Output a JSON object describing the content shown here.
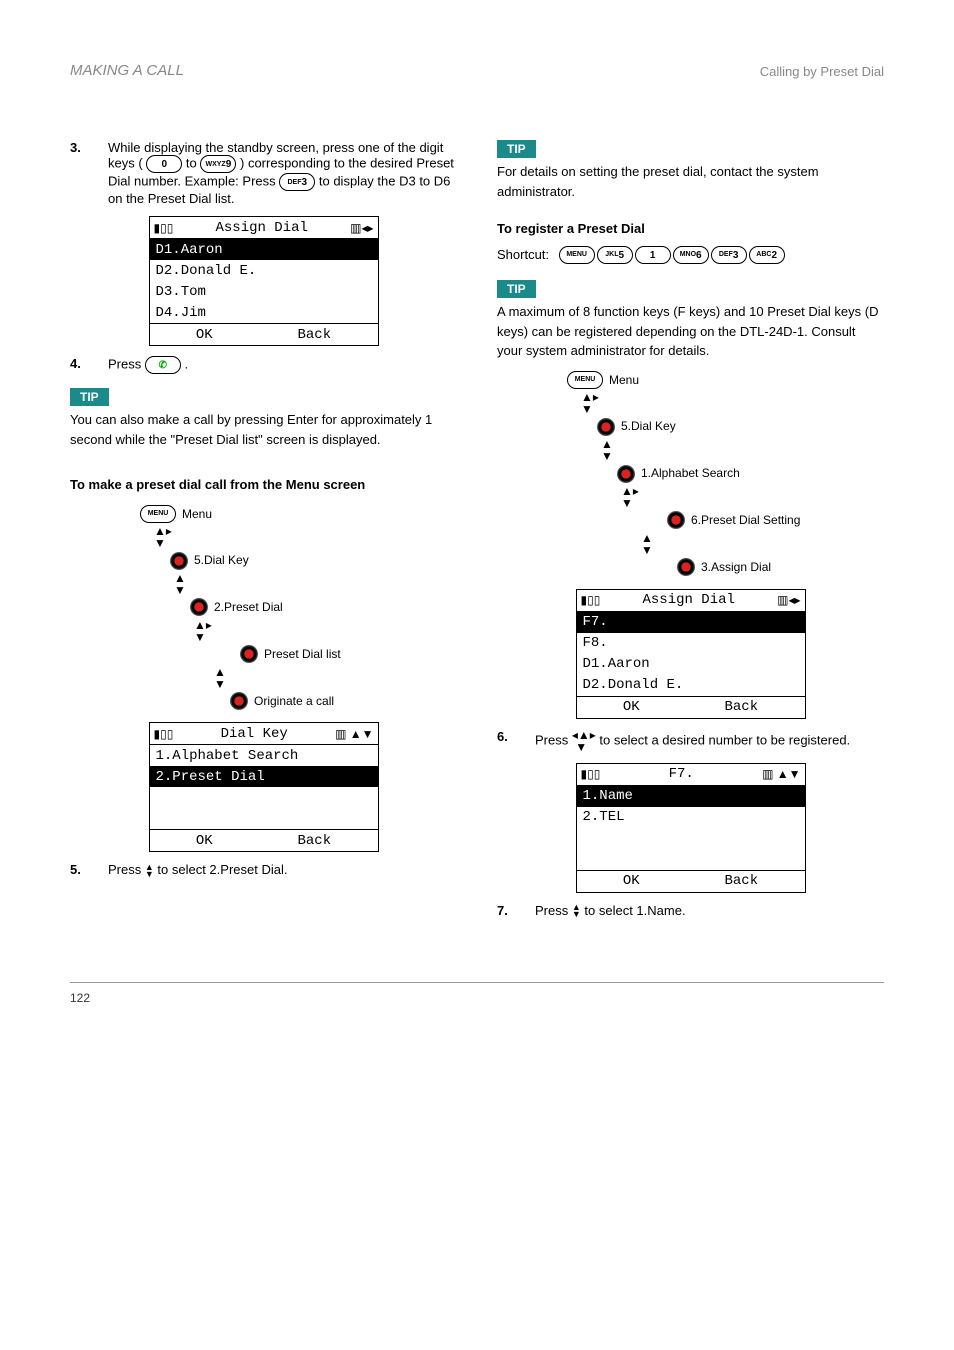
{
  "header": {
    "title": "MAKING A CALL",
    "subtitle": "Calling by Preset Dial"
  },
  "left": {
    "step3a": "While displaying the standby screen, press one of the digit keys (",
    "step3b": "to",
    "step3c": ") corresponding to the desired Preset Dial number. Example: Press",
    "step3d": "to display the D3 to D6 on the Preset Dial list.",
    "screen1": {
      "title": "Assign Dial",
      "rows": [
        "D1.Aaron",
        "D2.Donald E.",
        "D3.Tom",
        "D4.Jim"
      ],
      "ok": "OK",
      "back": "Back"
    },
    "step4a": "Press",
    "step4b": ".",
    "tip1": "You can also make a call by pressing Enter for approximately 1 second while the \"Preset Dial list\" screen is displayed.",
    "h_preset_title": "To make a preset dial call from the Menu screen",
    "menu_tree": {
      "menu": "Menu",
      "l1": "5.Dial Key",
      "l2": "2.Preset Dial",
      "l3": "Preset Dial list",
      "l4": "Originate a call"
    },
    "screen2": {
      "title": "Dial Key",
      "rows": [
        "1.Alphabet Search",
        "2.Preset Dial"
      ],
      "ok": "OK",
      "back": "Back"
    },
    "step5a": "Press",
    "step5b": "to select 2.Preset Dial."
  },
  "right": {
    "tip_top": "For details on setting the preset dial, contact the system administrator.",
    "h_preset_register": "To register a Preset Dial",
    "shortcut": "Shortcut:",
    "tip2": "A maximum of 8 function keys (F keys) and 10 Preset Dial keys (D keys) can be registered depending on the DTL-24D-1. Consult your system administrator for details.",
    "menu_tree2": {
      "menu": "Menu",
      "l1": "5.Dial Key",
      "l2": "1.Alphabet Search",
      "l3": "6.Preset Dial Setting",
      "l4": "3.Assign Dial"
    },
    "screen3": {
      "title": "Assign Dial",
      "rows": [
        "F7.",
        "F8.",
        "D1.Aaron",
        "D2.Donald E."
      ],
      "ok": "OK",
      "back": "Back"
    },
    "step6a": "Press",
    "step6b": "to select a desired number to be registered.",
    "screen4": {
      "title": "F7.",
      "rows": [
        "1.Name",
        "2.TEL"
      ],
      "ok": "OK",
      "back": "Back"
    },
    "step7a": "Press",
    "step7b": "to select 1.Name."
  },
  "footer": {
    "page": "122"
  }
}
